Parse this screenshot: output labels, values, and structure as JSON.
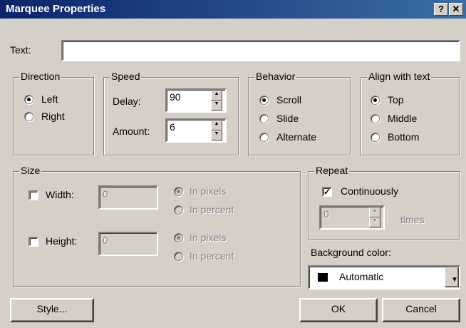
{
  "window": {
    "title": "Marquee Properties",
    "help_glyph": "?",
    "close_glyph": "✕"
  },
  "text_field": {
    "label": "Text:",
    "value": ""
  },
  "direction": {
    "legend": "Direction",
    "options": [
      "Left",
      "Right"
    ],
    "selected": "Left"
  },
  "speed": {
    "legend": "Speed",
    "delay_label": "Delay:",
    "delay_value": "90",
    "amount_label": "Amount:",
    "amount_value": "6"
  },
  "behavior": {
    "legend": "Behavior",
    "options": [
      "Scroll",
      "Slide",
      "Alternate"
    ],
    "selected": "Scroll"
  },
  "align": {
    "legend": "Align with text",
    "options": [
      "Top",
      "Middle",
      "Bottom"
    ],
    "selected": "Top"
  },
  "size": {
    "legend": "Size",
    "width_label": "Width:",
    "width_value": "0",
    "width_checked": false,
    "height_label": "Height:",
    "height_value": "0",
    "height_checked": false,
    "unit_pixels": "In pixels",
    "unit_percent": "In percent"
  },
  "repeat": {
    "legend": "Repeat",
    "continuously_label": "Continuously",
    "continuously_checked": true,
    "count_value": "0",
    "times_label": "times"
  },
  "background_color": {
    "label": "Background color:",
    "value": "Automatic",
    "swatch": "#000000"
  },
  "buttons": {
    "style": "Style...",
    "ok": "OK",
    "cancel": "Cancel"
  }
}
